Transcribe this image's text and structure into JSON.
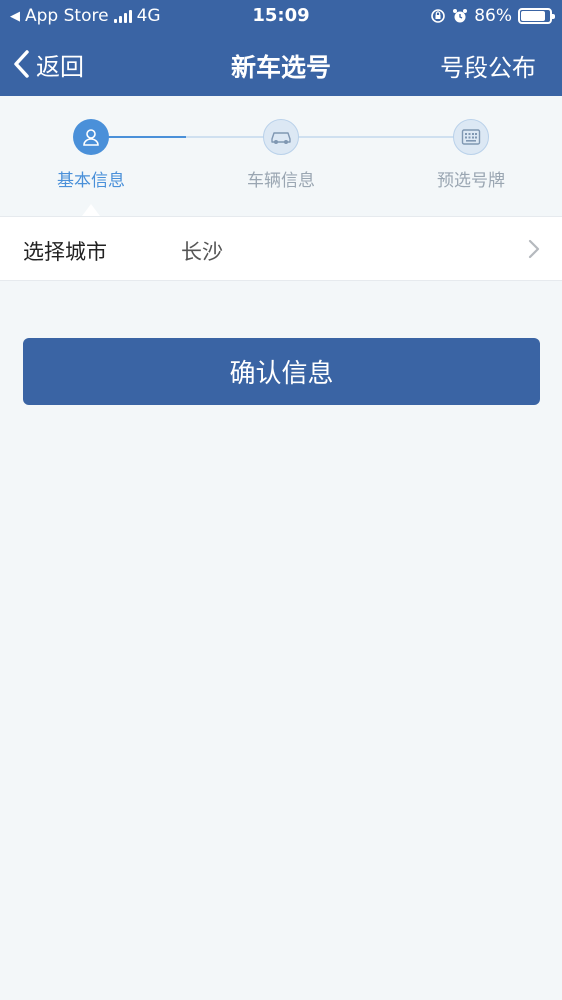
{
  "status_bar": {
    "back_app": "App Store",
    "network": "4G",
    "time": "15:09",
    "battery": "86%",
    "battery_level": 0.86
  },
  "nav": {
    "back_label": "返回",
    "title": "新车选号",
    "right_label": "号段公布"
  },
  "steps": [
    {
      "label": "基本信息",
      "icon": "user-icon",
      "active": true
    },
    {
      "label": "车辆信息",
      "icon": "car-icon",
      "active": false
    },
    {
      "label": "预选号牌",
      "icon": "keypad-icon",
      "active": false
    }
  ],
  "form": {
    "city_label": "选择城市",
    "city_value": "长沙"
  },
  "confirm_button": "确认信息",
  "colors": {
    "primary": "#3a64a4",
    "active_step": "#4a90d9",
    "inactive_step": "#9aa6b2",
    "background": "#f3f7f9"
  }
}
